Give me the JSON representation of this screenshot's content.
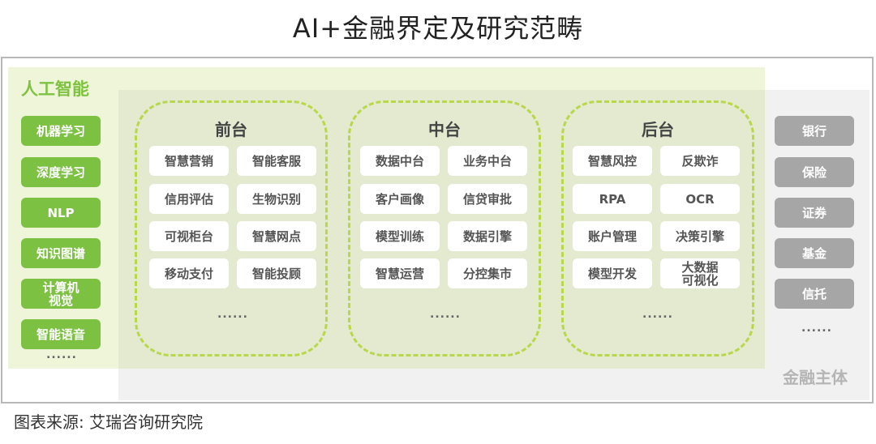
{
  "title": "AI+金融界定及研究范畴",
  "ai": {
    "title": "人工智能",
    "items": [
      "机器学习",
      "深度学习",
      "NLP",
      "知识图谱",
      "计算机\n视觉",
      "智能语音"
    ],
    "more": "......"
  },
  "sections": [
    {
      "title": "前台",
      "items": [
        "智慧营销",
        "智能客服",
        "信用评估",
        "生物识别",
        "可视柜台",
        "智慧网点",
        "移动支付",
        "智能投顾"
      ],
      "more": "......"
    },
    {
      "title": "中台",
      "items": [
        "数据中台",
        "业务中台",
        "客户画像",
        "信贷审批",
        "模型训练",
        "数据引擎",
        "智慧运营",
        "分控集市"
      ],
      "more": "......"
    },
    {
      "title": "后台",
      "items": [
        "智慧风控",
        "反欺诈",
        "RPA",
        "OCR",
        "账户管理",
        "决策引擎",
        "模型开发",
        "大数据\n可视化"
      ],
      "more": "......"
    }
  ],
  "finance": {
    "title": "金融主体",
    "items": [
      "银行",
      "保险",
      "证券",
      "基金",
      "信托"
    ],
    "more": "......"
  },
  "source": "图表来源: 艾瑞咨询研究院",
  "colors": {
    "ai_green": "#7dc143",
    "dash_green": "#b8d749",
    "finance_gray": "#a6a6a6"
  }
}
